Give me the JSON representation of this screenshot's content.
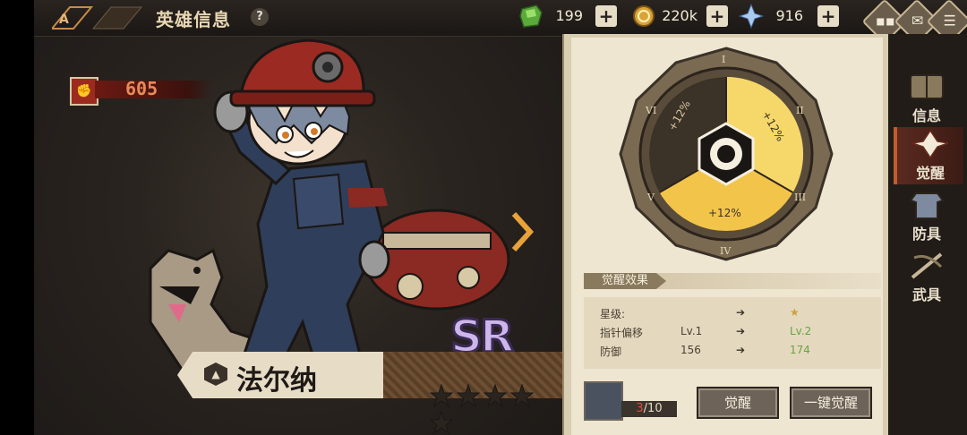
{
  "header": {
    "title": "英雄信息",
    "help": "?"
  },
  "resources": [
    {
      "name": "green-gem",
      "value": "199",
      "color": "#6ec24a"
    },
    {
      "name": "gold-coin",
      "value": "220k",
      "color": "#d9a33a"
    },
    {
      "name": "crystal",
      "value": "916",
      "color": "#8bb6ea"
    }
  ],
  "power": {
    "value": "605"
  },
  "hero": {
    "name": "法尔纳",
    "rarity": "SR",
    "stars": 5
  },
  "awaken": {
    "medallion": {
      "top_label": "+12%",
      "right_label": "+12%",
      "bottom_label": "+12%",
      "roman": [
        "I",
        "II",
        "III",
        "IV",
        "V",
        "VI"
      ]
    },
    "effect_title": "觉醒效果",
    "rows": [
      {
        "label": "星级:",
        "current": "",
        "next": "★"
      },
      {
        "label": "指针偏移",
        "current": "Lv.1",
        "next": "Lv.2"
      },
      {
        "label": "防御",
        "current": "156",
        "next": "174"
      }
    ],
    "material_count": {
      "have": "3",
      "need": "/10"
    },
    "buttons": {
      "awaken": "觉醒",
      "one_click": "一键觉醒"
    }
  },
  "sidebar": [
    {
      "label": "信息",
      "active": false
    },
    {
      "label": "觉醒",
      "active": true
    },
    {
      "label": "防具",
      "active": false
    },
    {
      "label": "武具",
      "active": false
    }
  ],
  "colors": {
    "accent": "#c45a2b",
    "panel": "#efe6d1"
  }
}
